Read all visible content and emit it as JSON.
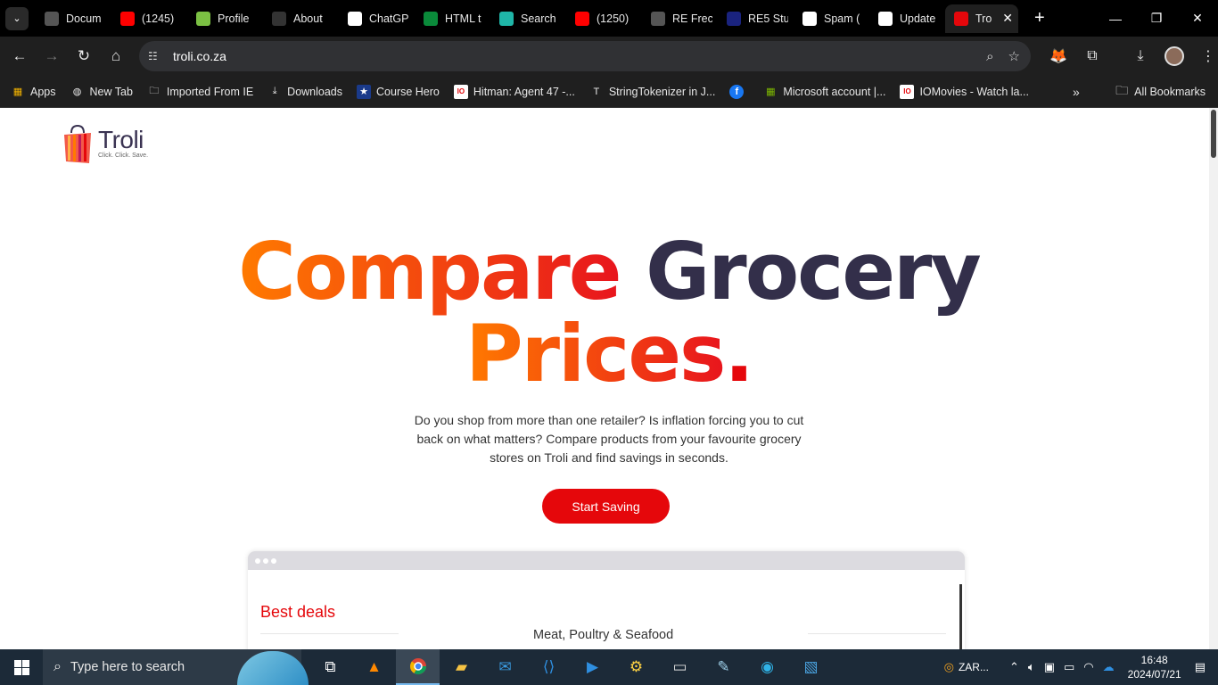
{
  "browser": {
    "tabs": [
      {
        "title": "Docum",
        "icon": "globe-icon",
        "color": "#555"
      },
      {
        "title": "(1245) ",
        "icon": "youtube-icon",
        "color": "#ff0000"
      },
      {
        "title": "Profile",
        "icon": "slack-like-icon",
        "color": "#7bc043"
      },
      {
        "title": "About ",
        "icon": "face-icon",
        "color": "#333"
      },
      {
        "title": "ChatGP",
        "icon": "chatgpt-icon",
        "color": "#fff"
      },
      {
        "title": "HTML t",
        "icon": "w-icon",
        "color": "#0a8a3a"
      },
      {
        "title": "Search",
        "icon": "vuetify-icon",
        "color": "#1fb6a8"
      },
      {
        "title": "(1250) ",
        "icon": "youtube-icon",
        "color": "#ff0000"
      },
      {
        "title": "RE Frec",
        "icon": "globe-icon",
        "color": "#555"
      },
      {
        "title": "RE5 Stu",
        "icon": "doc-icon",
        "color": "#1a237e"
      },
      {
        "title": "Spam (",
        "icon": "gmail-icon",
        "color": "#fff"
      },
      {
        "title": "Update",
        "icon": "gmail-icon",
        "color": "#fff"
      },
      {
        "title": "Tro",
        "icon": "troli-icon",
        "color": "#e5070b"
      }
    ],
    "url": "troli.co.za",
    "bookmarks": [
      {
        "label": "Apps",
        "icon": "apps-grid-icon"
      },
      {
        "label": "New Tab",
        "icon": "globe-icon"
      },
      {
        "label": "Imported From IE",
        "icon": "folder-icon"
      },
      {
        "label": "Downloads",
        "icon": "download-icon"
      },
      {
        "label": "Course Hero",
        "icon": "star-icon"
      },
      {
        "label": "Hitman: Agent 47 -...",
        "icon": "io-icon"
      },
      {
        "label": "StringTokenizer in J...",
        "icon": "t-icon"
      },
      {
        "label": "",
        "icon": "facebook-icon"
      },
      {
        "label": "Microsoft account |...",
        "icon": "microsoft-icon"
      },
      {
        "label": "IOMovies - Watch la...",
        "icon": "io-icon"
      }
    ],
    "all_bookmarks": "All Bookmarks"
  },
  "page": {
    "logo": {
      "name": "Troli",
      "tagline": "Click. Click. Save."
    },
    "hero": {
      "word1": "Compare",
      "word2": "Grocery",
      "word3": "Prices",
      "dot": ".",
      "description": "Do you shop from more than one retailer? Is inflation forcing you to cut back on what matters? Compare products from your favourite grocery stores on Troli and find savings in seconds."
    },
    "cta_label": "Start Saving",
    "preview": {
      "title": "Best deals",
      "category": "Meat, Poultry & Seafood"
    }
  },
  "taskbar": {
    "search_placeholder": "Type here to search",
    "tray_label": "ZAR...",
    "time": "16:48",
    "date": "2024/07/21"
  },
  "colors": {
    "accent_red": "#e5070b",
    "accent_orange": "#ff7a00",
    "dark_navy": "#332f4a"
  }
}
